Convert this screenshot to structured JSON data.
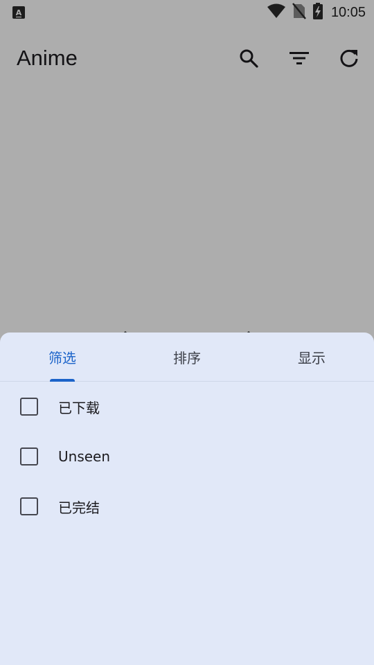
{
  "status_bar": {
    "time": "10:05",
    "icons": [
      "keyboard-a-icon",
      "wifi-icon",
      "no-sim-icon",
      "battery-charging-icon"
    ]
  },
  "toolbar": {
    "title": "Anime",
    "actions": [
      "search-icon",
      "filter-icon",
      "refresh-icon"
    ]
  },
  "sheet": {
    "tabs": [
      {
        "label": "筛选",
        "active": true
      },
      {
        "label": "排序",
        "active": false
      },
      {
        "label": "显示",
        "active": false
      }
    ],
    "filters": [
      {
        "label": "已下载",
        "checked": false
      },
      {
        "label": "Unseen",
        "checked": false
      },
      {
        "label": "已完结",
        "checked": false
      }
    ]
  },
  "colors": {
    "accent": "#1b63c9",
    "sheet_background": "#e1e8f8",
    "scrim": "rgba(0,0,0,0.32)"
  }
}
